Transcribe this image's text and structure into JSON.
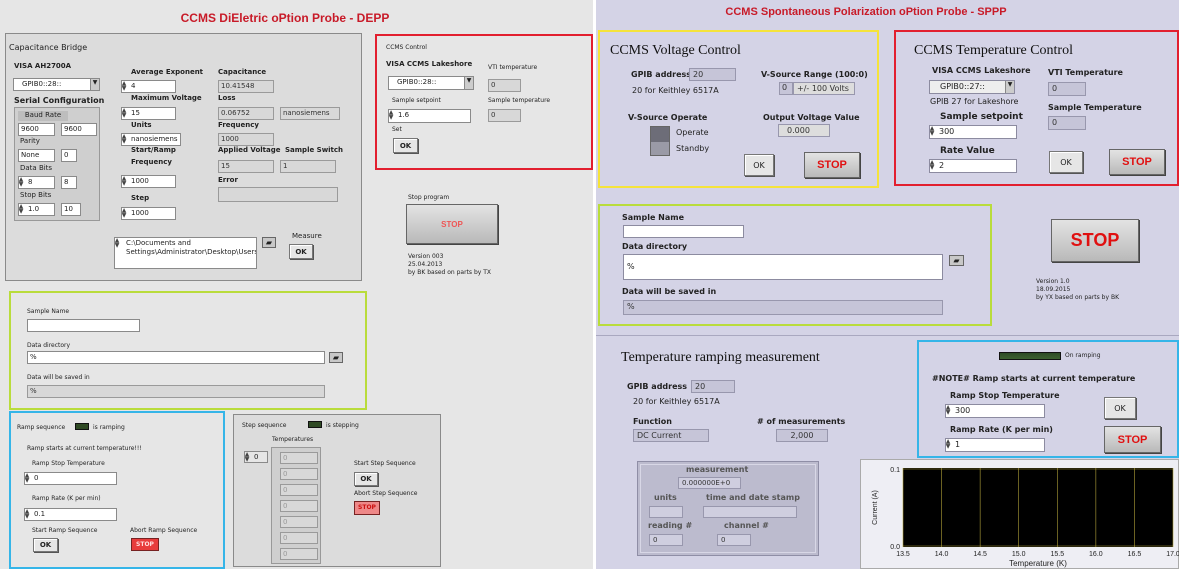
{
  "depp": {
    "title": "CCMS DiEletric oPtion Probe - DEPP",
    "cap_bridge": {
      "label": "Capacitance Bridge",
      "visa_label": "VISA AH2700A",
      "visa_value": "GPIB0::28::",
      "serial_label": "Serial Configuration",
      "baud_label": "Baud Rate",
      "baud_value": "9600",
      "baud_ind": "9600",
      "parity_label": "Parity",
      "parity_value": "None",
      "parity_ind": "0",
      "databits_label": "Data Bits",
      "databits_value": "8",
      "databits_ind": "8",
      "stopbits_label": "Stop Bits",
      "stopbits_value": "1.0",
      "stopbits_ind": "10",
      "avg_exp_label": "Average Exponent",
      "avg_exp_value": "4",
      "max_volt_label": "Maximum Voltage",
      "max_volt_value": "15",
      "units_label": "Units",
      "units_value": "nanosiemens",
      "start_ramp_label": "Start/Ramp",
      "freq_label": "Frequency",
      "freq_value": "1000",
      "step_label": "Step",
      "step_value": "1000",
      "capacitance_label": "Capacitance",
      "capacitance_value": "10.41548",
      "loss_label": "Loss",
      "loss_value": "0.06752",
      "loss_unit": "nanosiemens",
      "frequency_label": "Frequency",
      "frequency_value": "1000",
      "applied_volt_label": "Applied Voltage",
      "applied_volt_value": "15",
      "sample_switch_label": "Sample Switch",
      "sample_switch_value": "1",
      "error_label": "Error",
      "path_value": "C:\\Documents and Settings\\Administrator\\Desktop\\Users\\",
      "measure_label": "Measure",
      "measure_btn": "OK"
    },
    "control": {
      "label": "CCMS Control",
      "visa_label": "VISA CCMS Lakeshore",
      "visa_value": "GPIB0::28::",
      "vti_label": "VTI temperature",
      "vti_value": "0",
      "setpoint_label": "Sample setpoint",
      "setpoint_value": "1.6",
      "sample_temp_label": "Sample temperature",
      "sample_temp_value": "0",
      "set_label": "Set",
      "set_btn": "OK"
    },
    "stop": {
      "label": "Stop program",
      "btn": "STOP",
      "version": "Version 003",
      "date": "25.04.2013",
      "credit": "by BK based on parts by TX"
    },
    "sample": {
      "name_label": "Sample Name",
      "dir_label": "Data directory",
      "dir_value": "%",
      "saved_label": "Data will be saved in",
      "saved_value": "%"
    },
    "ramp": {
      "label": "Ramp sequence",
      "led_label": "is ramping",
      "note": "Ramp starts at current temperature!!!",
      "stop_temp_label": "Ramp Stop Temperature",
      "stop_temp_value": "0",
      "rate_label": "Ramp Rate (K per min)",
      "rate_value": "0.1",
      "start_label": "Start Ramp Sequence",
      "start_btn": "OK",
      "abort_label": "Abort Ramp Sequence",
      "abort_btn": "STOP"
    },
    "stepseq": {
      "label": "Step sequence",
      "led_label": "is stepping",
      "temps_label": "Temperatures",
      "index_value": "0",
      "temps": [
        "0",
        "0",
        "0",
        "0",
        "0",
        "0",
        "0"
      ],
      "start_label": "Start Step Sequence",
      "start_btn": "OK",
      "abort_label": "Abort Step Sequence",
      "abort_btn": "STOP"
    }
  },
  "sppp": {
    "title": "CCMS Spontaneous Polarization oPtion Probe - SPPP",
    "voltage": {
      "header": "CCMS Voltage Control",
      "gpib_label": "GPIB address",
      "gpib_value": "20",
      "keithley_note": "20 for Keithley 6517A",
      "range_label": "V-Source Range (100:0)",
      "range_index": "0",
      "range_value": "+/- 100 Volts",
      "operate_label": "V-Source Operate",
      "operate": "Operate",
      "standby": "Standby",
      "output_label": "Output Voltage Value",
      "output_value": "0.000",
      "ok_btn": "OK",
      "stop_btn": "STOP"
    },
    "temp": {
      "header": "CCMS Temperature Control",
      "visa_label": "VISA CCMS Lakeshore",
      "visa_value": "GPIB0::27::",
      "gpib_note": "GPIB 27 for Lakeshore",
      "setpoint_label": "Sample setpoint",
      "setpoint_value": "300",
      "rate_label": "Rate Value",
      "rate_value": "2",
      "vti_label": "VTI Temperature",
      "vti_value": "0",
      "sample_temp_label": "Sample Temperature",
      "sample_temp_value": "0",
      "ok_btn": "OK",
      "stop_btn": "STOP"
    },
    "sample": {
      "name_label": "Sample Name",
      "dir_label": "Data directory",
      "dir_value": "%",
      "saved_label": "Data will be saved in",
      "saved_value": "%"
    },
    "stop": {
      "btn": "STOP",
      "version": "Version 1.0",
      "date": "18.09.2015",
      "credit": "by YX based on parts by BK"
    },
    "ramp_meas": {
      "header": "Temperature ramping measurement",
      "gpib_label": "GPIB address",
      "gpib_value": "20",
      "keithley_note": "20 for Keithley 6517A",
      "function_label": "Function",
      "function_value": "DC Current",
      "nmeas_label": "# of measurements",
      "nmeas_value": "2,000"
    },
    "measurement": {
      "label": "measurement",
      "value": "0.000000E+0",
      "units_label": "units",
      "time_label": "time and date stamp",
      "reading_label": "reading #",
      "reading_value": "0",
      "channel_label": "channel #",
      "channel_value": "0"
    },
    "ramping": {
      "led_label": "On ramping",
      "note": "#NOTE# Ramp starts at current temperature",
      "stop_label": "Ramp Stop Temperature",
      "stop_value": "300",
      "rate_label": "Ramp Rate (K per min)",
      "rate_value": "1",
      "ok_btn": "OK",
      "stop_btn": "STOP"
    }
  },
  "chart_data": {
    "type": "line",
    "xlabel": "Temperature (K)",
    "ylabel": "Current (A)",
    "xlim": [
      13.5,
      17.0
    ],
    "ylim": [
      0.0,
      0.1
    ],
    "x_ticks": [
      "13.5",
      "14.0",
      "14.5",
      "15.0",
      "15.5",
      "16.0",
      "16.5",
      "17.0"
    ],
    "y_ticks": [
      "0.1",
      "0.0"
    ],
    "grid": true,
    "series": [
      {
        "x": [],
        "y": []
      }
    ]
  },
  "colors": {
    "title_red": "#c81a28",
    "stop_red": "#e01010",
    "yellow": "#f5e33a",
    "red_box": "#e21f2f",
    "green_box": "#b9dc3b",
    "blue_box": "#35b5e8",
    "plot_bg": "#000000",
    "grid": "#b4a33a"
  }
}
